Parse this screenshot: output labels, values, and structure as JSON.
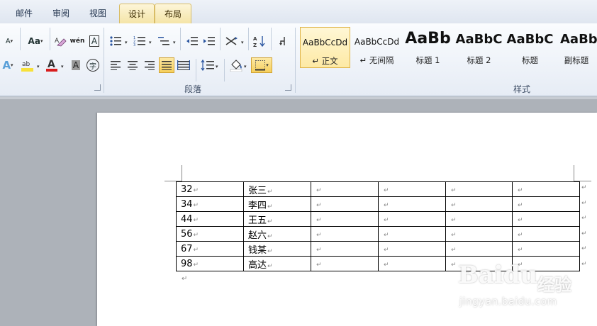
{
  "tabs": [
    {
      "label": "邮件",
      "active": false
    },
    {
      "label": "审阅",
      "active": false
    },
    {
      "label": "视图",
      "active": false
    },
    {
      "label": "设计",
      "active": true
    },
    {
      "label": "布局",
      "active": true
    }
  ],
  "groups": {
    "paragraph": "段落",
    "styles": "样式"
  },
  "font_tools": {
    "shrink_font": "A",
    "change_case": "Aa",
    "phonetic": "wén",
    "char_border": "A",
    "font_color": "A",
    "char_shading": "A",
    "enclose_char": "字"
  },
  "styles": [
    {
      "sample": "AaBbCcDd",
      "name": "↵ 正文",
      "selected": true
    },
    {
      "sample": "AaBbCcDd",
      "name": "↵ 无间隔",
      "selected": false
    },
    {
      "sample": "AaBb",
      "name": "标题 1",
      "selected": false
    },
    {
      "sample": "AaBbC",
      "name": "标题 2",
      "selected": false
    },
    {
      "sample": "AaBbC",
      "name": "标题",
      "selected": false
    },
    {
      "sample": "AaBb",
      "name": "副标题",
      "selected": false
    }
  ],
  "table": {
    "rows": [
      [
        "32",
        "张三",
        "",
        "",
        "",
        ""
      ],
      [
        "34",
        "李四",
        "",
        "",
        "",
        ""
      ],
      [
        "44",
        "王五",
        "",
        "",
        "",
        ""
      ],
      [
        "56",
        "赵六",
        "",
        "",
        "",
        ""
      ],
      [
        "67",
        "钱某",
        "",
        "",
        "",
        ""
      ],
      [
        "98",
        "高达",
        "",
        "",
        "",
        ""
      ]
    ],
    "cell_mark": "↵",
    "row_mark": "↵"
  },
  "paragraph_mark": "↵",
  "watermark": {
    "brand": "Baidu",
    "cn": "经验",
    "url": "jingyan.baidu.com"
  },
  "colors": {
    "highlight_yellow": "#f7e13a",
    "font_color_red": "#d81e1e",
    "ribbon_bg": "#e6ecf5",
    "active_tab": "#f4e4a6"
  }
}
